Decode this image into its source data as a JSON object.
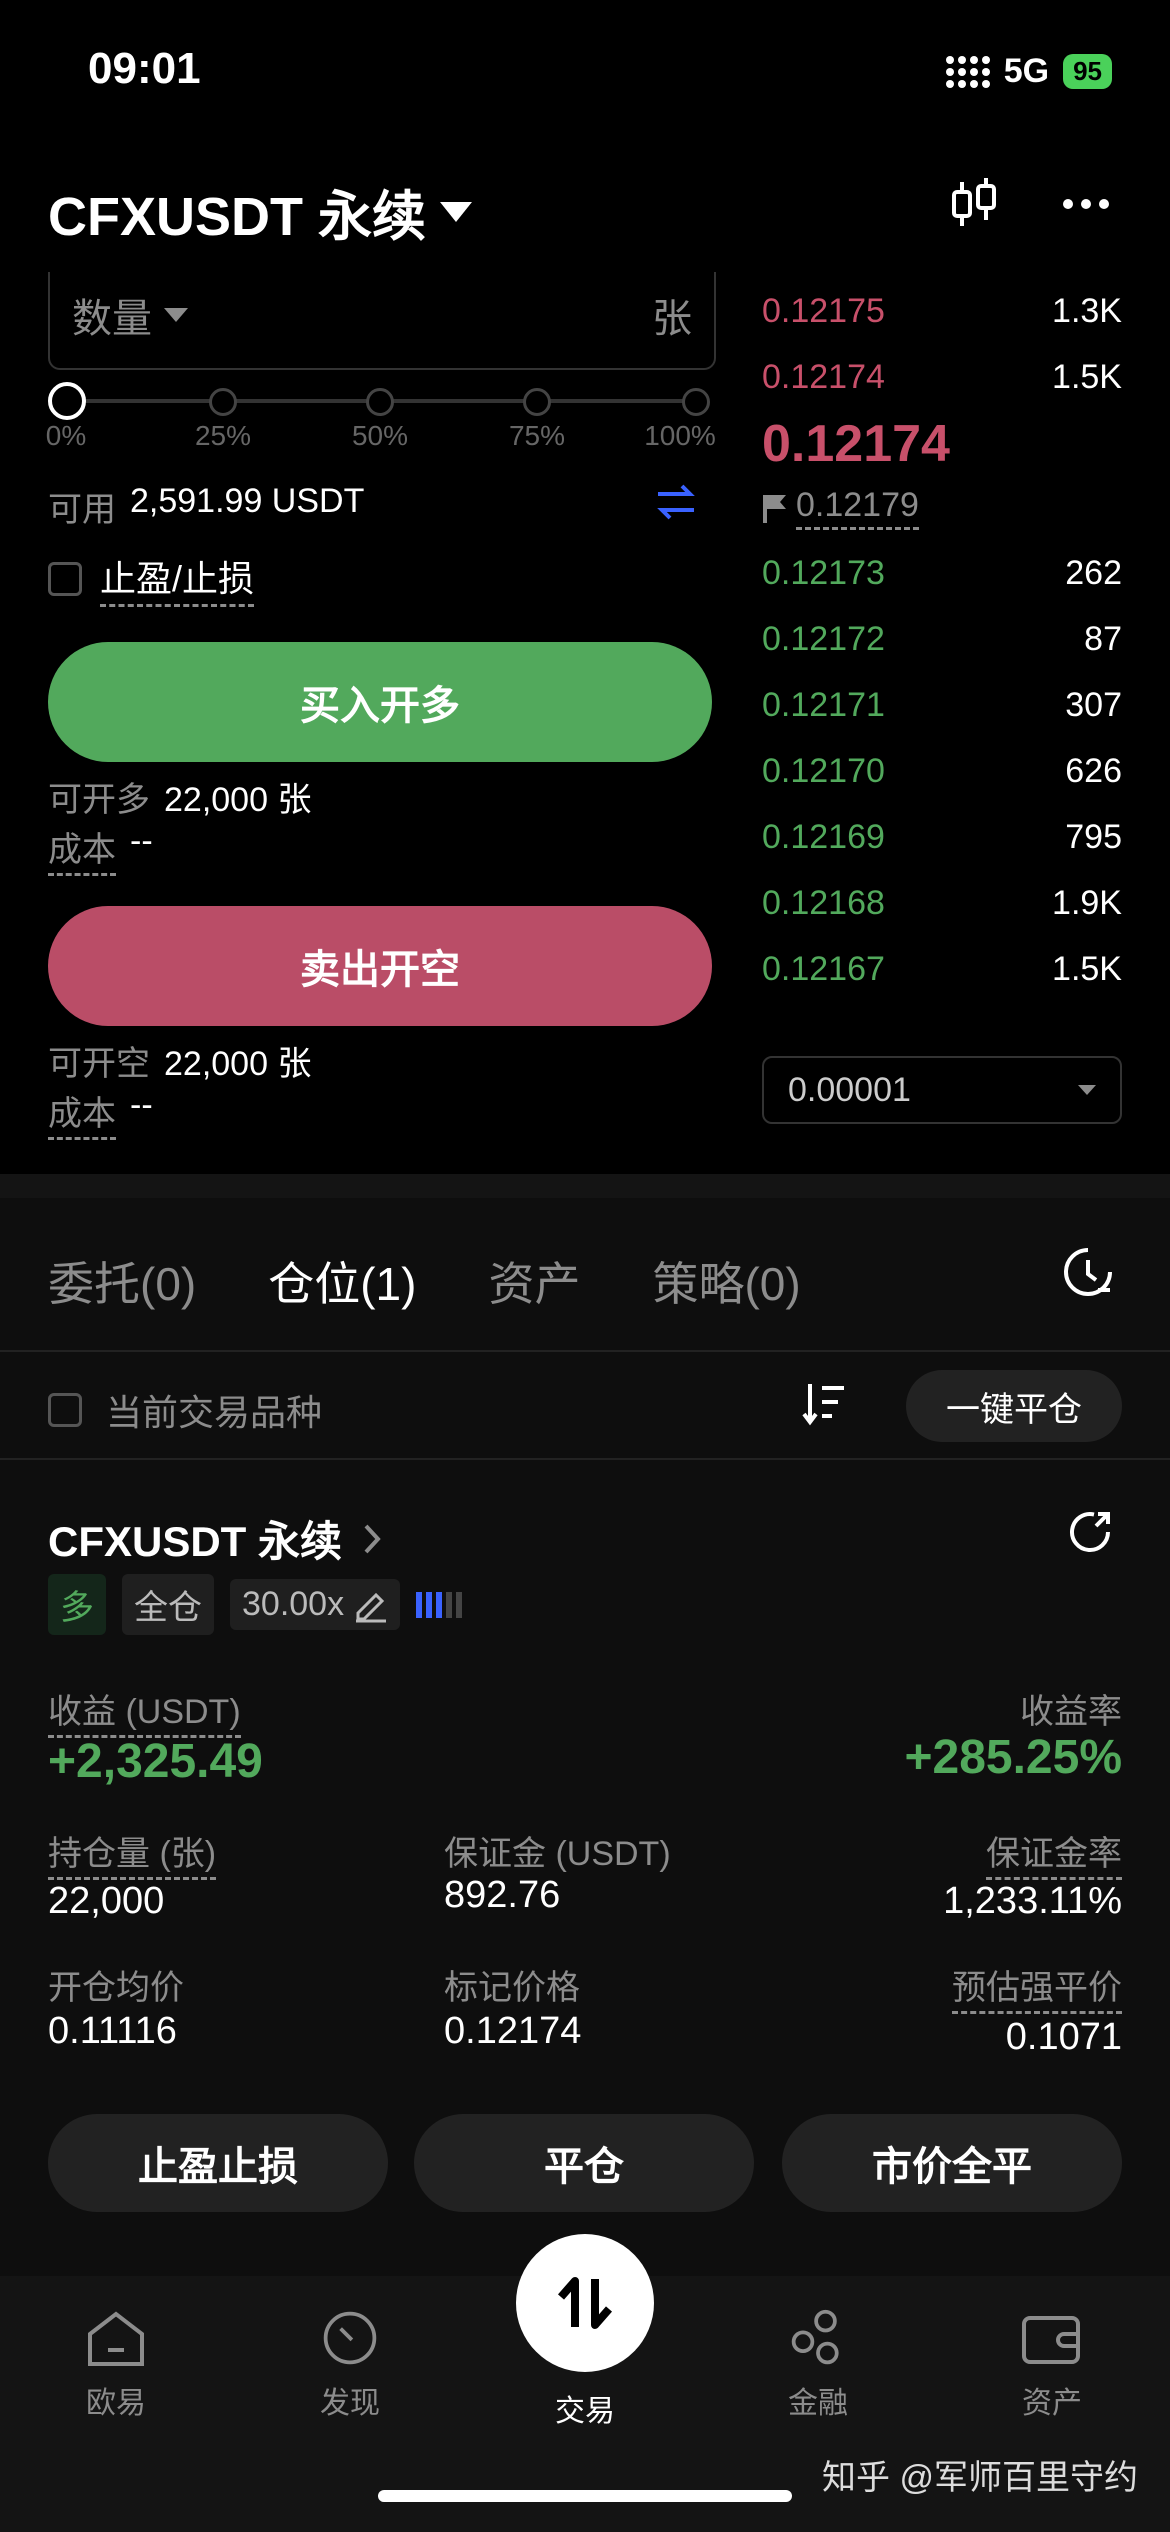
{
  "status": {
    "time": "09:01",
    "network": "5G",
    "battery": "95"
  },
  "header": {
    "title": "CFXUSDT 永续"
  },
  "order_form": {
    "qty_label": "数量",
    "qty_unit": "张",
    "slider_labels": [
      "0%",
      "25%",
      "50%",
      "75%",
      "100%"
    ],
    "slider_value_percent": 0,
    "available_label": "可用",
    "available_value": "2,591.99 USDT",
    "tpsl_label": "止盈/止损",
    "buy_label": "买入开多",
    "buy_max_label": "可开多",
    "buy_max_value": "22,000 张",
    "buy_cost_label": "成本",
    "buy_cost_value": "--",
    "sell_label": "卖出开空",
    "sell_max_label": "可开空",
    "sell_max_value": "22,000 张",
    "sell_cost_label": "成本",
    "sell_cost_value": "--"
  },
  "order_book": {
    "asks": [
      {
        "price": "0.12175",
        "size": "1.3K"
      },
      {
        "price": "0.12174",
        "size": "1.5K"
      }
    ],
    "last_price": "0.12174",
    "mark_price": "0.12179",
    "bids": [
      {
        "price": "0.12173",
        "size": "262"
      },
      {
        "price": "0.12172",
        "size": "87"
      },
      {
        "price": "0.12171",
        "size": "307"
      },
      {
        "price": "0.12170",
        "size": "626"
      },
      {
        "price": "0.12169",
        "size": "795"
      },
      {
        "price": "0.12168",
        "size": "1.9K"
      },
      {
        "price": "0.12167",
        "size": "1.5K"
      }
    ],
    "tick_size": "0.00001"
  },
  "tabs": [
    {
      "label": "委托(0)"
    },
    {
      "label": "仓位(1)"
    },
    {
      "label": "资产"
    },
    {
      "label": "策略(0)"
    }
  ],
  "filter": {
    "current_symbol_label": "当前交易品种",
    "close_all_label": "一键平仓"
  },
  "position": {
    "title": "CFXUSDT 永续",
    "side_tag": "多",
    "margin_mode_tag": "全仓",
    "leverage_tag": "30.00x",
    "pnl_label": "收益 (USDT)",
    "pnl_value": "+2,325.49",
    "roi_label": "收益率",
    "roi_value": "+285.25%",
    "size_label": "持仓量 (张)",
    "size_value": "22,000",
    "margin_label": "保证金 (USDT)",
    "margin_value": "892.76",
    "margin_ratio_label": "保证金率",
    "margin_ratio_value": "1,233.11%",
    "entry_label": "开仓均价",
    "entry_value": "0.11116",
    "mark_label": "标记价格",
    "mark_value": "0.12174",
    "liq_label": "预估强平价",
    "liq_value": "0.1071",
    "buttons": {
      "tpsl": "止盈止损",
      "close": "平仓",
      "market_close": "市价全平"
    }
  },
  "nav": {
    "items": [
      "欧易",
      "发现",
      "交易",
      "金融",
      "资产"
    ]
  },
  "watermark": "知乎 @军师百里守约",
  "colors": {
    "green": "#52a95c",
    "red": "#ba4d67",
    "accent_blue": "#3a62ff"
  }
}
